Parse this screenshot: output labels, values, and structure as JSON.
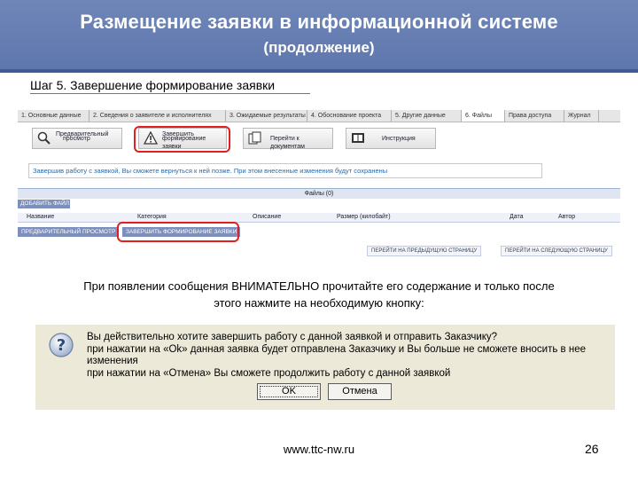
{
  "header": {
    "title": "Размещение заявки в информационной системе",
    "subtitle": "(продолжение)"
  },
  "step_title": "Шаг 5. Завершение формирование заявки",
  "screenshot": {
    "tabs": [
      "1. Основные данные",
      "2. Сведения о заявителе и исполнителях",
      "3. Ожидаемые результаты",
      "4. Обоснование проекта",
      "5. Другие данные",
      "6. Файлы",
      "Права доступа",
      "Журнал"
    ],
    "active_tab_index": 5,
    "buttons": {
      "preview": [
        "Предварительный",
        "просмотр"
      ],
      "finish": [
        "Завершить",
        "формирование заявки"
      ],
      "to_documents": "Перейти к документам",
      "instruction": "Инструкция"
    },
    "notice": "Завершив работу с заявкой, Вы сможете вернуться к ней позже. При этом внесенные изменения будут сохранены",
    "files_title": "Файлы (0)",
    "add_file": "ДОБАВИТЬ ФАЙЛ",
    "columns": [
      "Название",
      "Категория",
      "Описание",
      "Размер (килобайт)",
      "Дата",
      "Автор"
    ],
    "action_buttons": [
      "ПРЕДВАРИТЕЛЬНЫЙ ПРОСМОТР",
      "ЗАВЕРШИТЬ ФОРМИРОВАНИЕ ЗАЯВКИ"
    ],
    "nav_buttons": [
      "ПЕРЕЙТИ НА ПРЕДЫДУЩУЮ СТРАНИЦУ",
      "ПЕРЕЙТИ НА СЛЕДУЮЩУЮ СТРАНИЦУ"
    ]
  },
  "instruction": [
    "При появлении сообщения ВНИМАТЕЛЬНО прочитайте его содержание и только после",
    "этого нажмите на необходимую кнопку:"
  ],
  "dialog": {
    "lines": [
      "Вы действительно хотите завершить работу с данной заявкой и отправить Заказчику?",
      "при нажатии на «Ok» данная заявка будет отправлена Заказчику и Вы больше не сможете вносить в нее изменения",
      "при нажатии на «Отмена» Вы сможете продолжить работу с данной заявкой"
    ],
    "ok_label": "OK",
    "cancel_label": "Отмена"
  },
  "footer": {
    "url": "www.ttc-nw.ru",
    "page_number": "26"
  },
  "colors": {
    "header_bg": "#6f86b8",
    "highlight_red": "#e02020",
    "notice_text": "#2a6aa8",
    "dialog_bg": "#ece9d8"
  }
}
